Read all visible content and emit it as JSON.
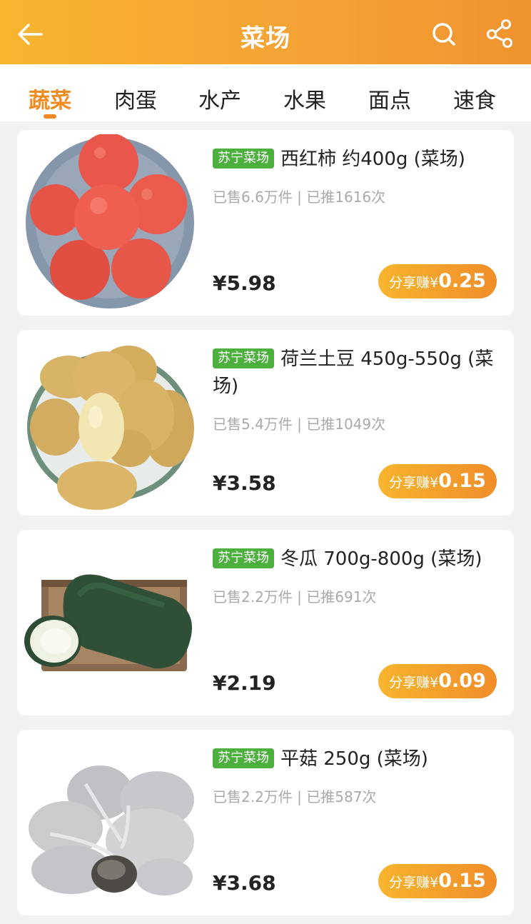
{
  "header": {
    "title": "菜场",
    "back_icon": "arrow-left-icon",
    "search_icon": "search-icon",
    "share_icon": "share-icon",
    "bg_colors": [
      "#f7b52e",
      "#ef9330"
    ]
  },
  "tabs": [
    {
      "label": "蔬菜",
      "active": true
    },
    {
      "label": "肉蛋",
      "active": false
    },
    {
      "label": "水产",
      "active": false
    },
    {
      "label": "水果",
      "active": false
    },
    {
      "label": "面点",
      "active": false
    },
    {
      "label": "速食",
      "active": false
    }
  ],
  "accent_color": "#f08a22",
  "badge_color": "#4caf3e",
  "products": [
    {
      "badge": "苏宁菜场",
      "name": "西红柿 约400g (菜场)",
      "stats": "已售6.6万件 | 已推1616次",
      "price": "¥5.98",
      "earn_label": "分享赚¥",
      "earn_amount": "0.25",
      "image": "tomatoes"
    },
    {
      "badge": "苏宁菜场",
      "name": "荷兰土豆 450g-550g (菜场)",
      "stats": "已售5.4万件 | 已推1049次",
      "price": "¥3.58",
      "earn_label": "分享赚¥",
      "earn_amount": "0.15",
      "image": "potatoes"
    },
    {
      "badge": "苏宁菜场",
      "name": "冬瓜 700g-800g (菜场)",
      "stats": "已售2.2万件 | 已推691次",
      "price": "¥2.19",
      "earn_label": "分享赚¥",
      "earn_amount": "0.09",
      "image": "winter-melon"
    },
    {
      "badge": "苏宁菜场",
      "name": "平菇 250g (菜场)",
      "stats": "已售2.2万件 | 已推587次",
      "price": "¥3.68",
      "earn_label": "分享赚¥",
      "earn_amount": "0.15",
      "image": "oyster-mushrooms"
    }
  ]
}
